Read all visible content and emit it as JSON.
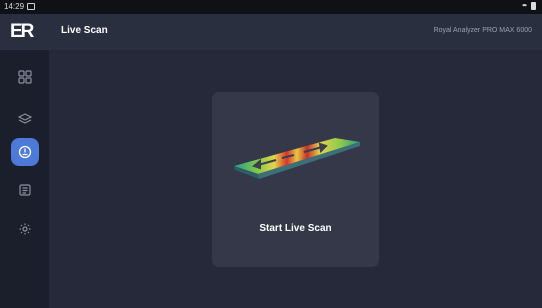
{
  "status_bar": {
    "time": "14:29"
  },
  "header": {
    "logo_text": "ER",
    "title": "Live Scan",
    "device_name": "Royal Analyzer PRO MAX 6000"
  },
  "sidebar": {
    "items": [
      {
        "name": "dashboard",
        "icon": "grid-icon",
        "active": false
      },
      {
        "name": "layers",
        "icon": "layers-icon",
        "active": false
      },
      {
        "name": "live-scan",
        "icon": "scan-icon",
        "active": true
      },
      {
        "name": "3d-view",
        "icon": "3d-box-icon",
        "active": false
      },
      {
        "name": "settings",
        "icon": "gear-icon",
        "active": false
      }
    ]
  },
  "main": {
    "start_card": {
      "label": "Start Live Scan",
      "icon": "scan-preview-graphic"
    }
  },
  "colors": {
    "accent": "#4d79d9",
    "background": "#25293a",
    "card": "#343848",
    "sidebar": "#1b1f2b"
  }
}
